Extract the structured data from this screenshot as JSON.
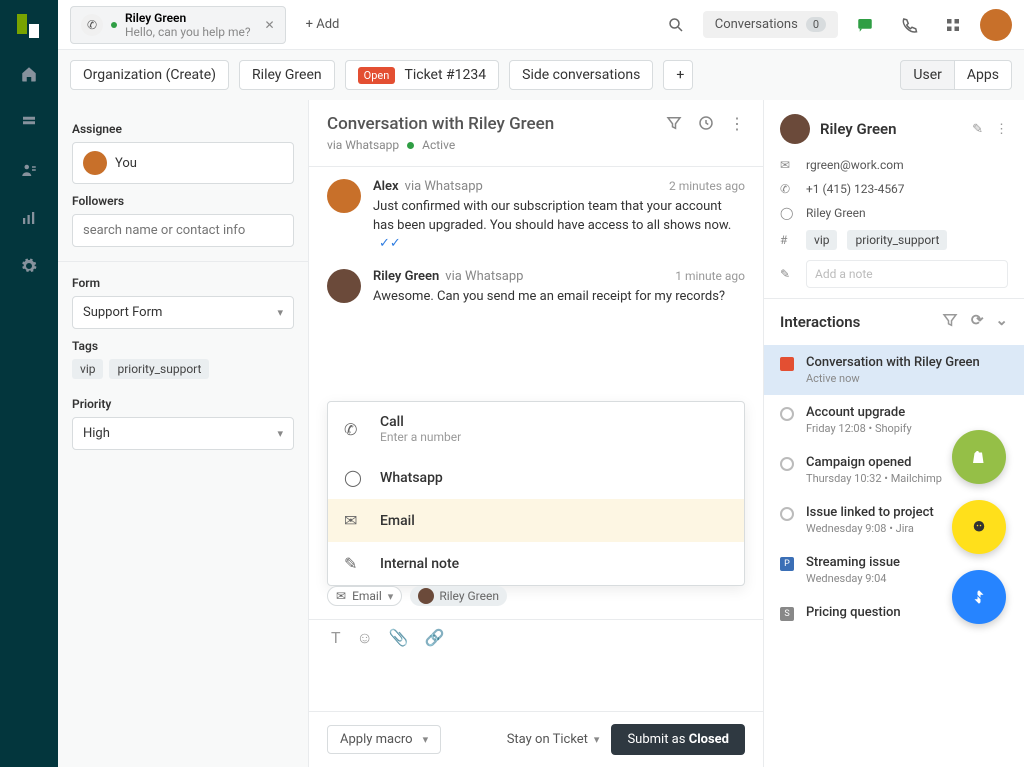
{
  "topbar": {
    "ticket_name": "Riley Green",
    "ticket_sub": "Hello, can you help me?",
    "add_label": "+ Add",
    "conv_label": "Conversations",
    "conv_count": "0"
  },
  "tabs": {
    "org": "Organization (Create)",
    "user": "Riley Green",
    "open_badge": "Open",
    "ticket": "Ticket #1234",
    "side": "Side conversations",
    "plus": "+",
    "right_user": "User",
    "right_apps": "Apps"
  },
  "left": {
    "assignee_label": "Assignee",
    "assignee_value": "You",
    "followers_label": "Followers",
    "followers_placeholder": "search name or contact info",
    "form_label": "Form",
    "form_value": "Support Form",
    "tags_label": "Tags",
    "tags": [
      "vip",
      "priority_support"
    ],
    "priority_label": "Priority",
    "priority_value": "High"
  },
  "conv": {
    "title": "Conversation with Riley Green",
    "via": "via Whatsapp",
    "status": "Active",
    "messages": [
      {
        "name": "Alex",
        "via": "via Whatsapp",
        "time": "2 minutes ago",
        "text": "Just confirmed with our subscription team that your account has been upgraded. You should have access to all shows now."
      },
      {
        "name": "Riley Green",
        "via": "via Whatsapp",
        "time": "1 minute ago",
        "text": "Awesome. Can you send me an email receipt for my records?"
      }
    ],
    "channel_menu": [
      {
        "label": "Call",
        "sub": "Enter a number"
      },
      {
        "label": "Whatsapp",
        "sub": ""
      },
      {
        "label": "Email",
        "sub": ""
      },
      {
        "label": "Internal note",
        "sub": ""
      }
    ],
    "compose_channel": "Email",
    "recipient": "Riley Green",
    "macro": "Apply macro",
    "stay": "Stay on Ticket",
    "submit_prefix": "Submit as ",
    "submit_status": "Closed"
  },
  "customer": {
    "name": "Riley Green",
    "email": "rgreen@work.com",
    "phone": "+1 (415) 123-4567",
    "whatsapp": "Riley Green",
    "tags": [
      "vip",
      "priority_support"
    ],
    "note_placeholder": "Add a note"
  },
  "interactions": {
    "title": "Interactions",
    "items": [
      {
        "title": "Conversation with Riley Green",
        "sub": "Active now",
        "active": true
      },
      {
        "title": "Account upgrade",
        "sub": "Friday 12:08 • Shopify"
      },
      {
        "title": "Campaign opened",
        "sub": "Thursday 10:32 • Mailchimp"
      },
      {
        "title": "Issue linked to project",
        "sub": "Wednesday 9:08 • Jira"
      },
      {
        "title": "Streaming issue",
        "sub": "Wednesday 9:04",
        "sq": "P"
      },
      {
        "title": "Pricing question",
        "sub": "",
        "sq": "S"
      }
    ]
  }
}
